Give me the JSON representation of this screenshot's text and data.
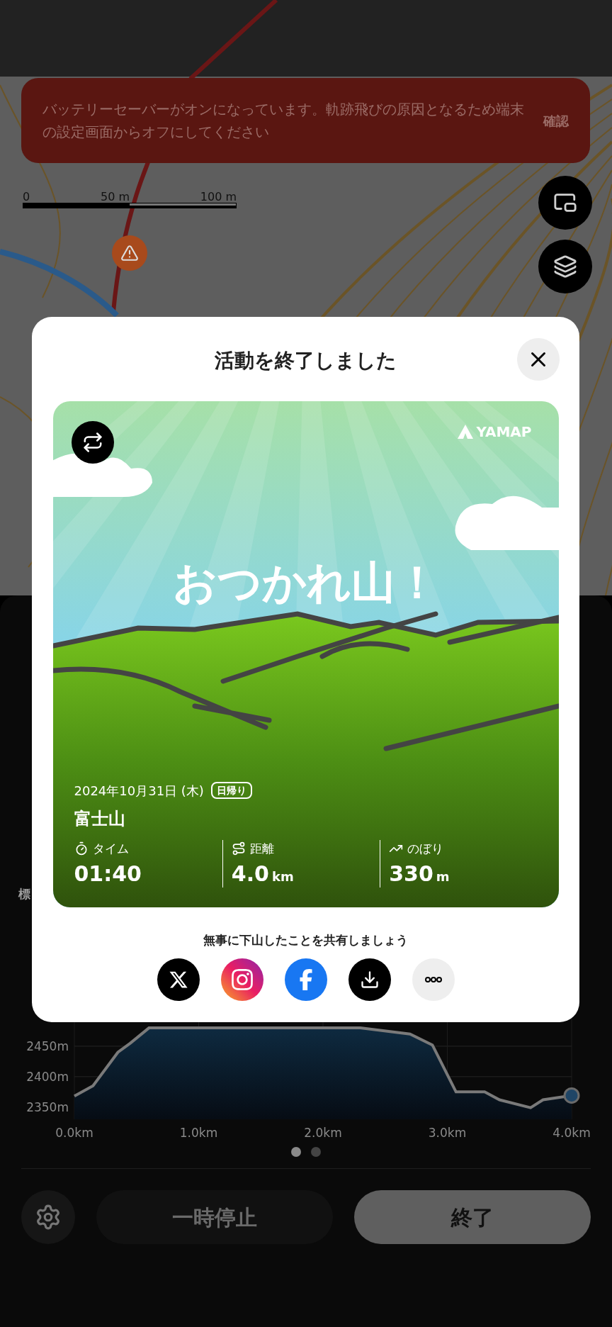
{
  "map": {
    "scale_labels": [
      "0",
      "50 m",
      "100 m"
    ],
    "buttons": [
      {
        "kind": "shrink"
      },
      {
        "kind": "layers"
      }
    ]
  },
  "banner": {
    "message": "バッテリーセーバーがオンになっています。軌跡飛びの原因となるため端末の設定画面からオフにしてください",
    "action": "確認"
  },
  "panel": {
    "chart_label": "標",
    "chart_data": {
      "type": "area",
      "x": [
        0,
        0.15,
        0.35,
        0.45,
        0.6,
        2.3,
        2.7,
        2.88,
        3.07,
        3.3,
        3.42,
        3.67,
        3.77,
        4.0
      ],
      "series": [
        {
          "color": "#7a7a7a",
          "values": [
            2368,
            2385,
            2440,
            2455,
            2480,
            2480,
            2470,
            2452,
            2375,
            2375,
            2362,
            2349,
            2362,
            2369
          ]
        }
      ],
      "xlim": [
        0,
        4
      ],
      "grid": true,
      "ylim": [
        2330,
        2600
      ],
      "xticks": [
        {
          "value": 0,
          "label": "0.0km"
        },
        {
          "value": 1,
          "label": "1.0km"
        },
        {
          "value": 2,
          "label": "2.0km"
        },
        {
          "value": 3,
          "label": "3.0km"
        },
        {
          "value": 4,
          "label": "4.0km"
        }
      ],
      "yticks": [
        {
          "value": 2350,
          "label": "2350m"
        },
        {
          "value": 2400,
          "label": "2400m"
        },
        {
          "value": 2450,
          "label": "2450m"
        }
      ]
    },
    "pages": [
      {
        "selected": true
      },
      {
        "selected": false
      }
    ],
    "buttons": [
      {
        "kind": "secondary",
        "label": "一時停止"
      },
      {
        "kind": "primary",
        "label": "終了"
      }
    ]
  },
  "dialog": {
    "title": "活動を終了しました",
    "card": {
      "logo": "YAMAP",
      "headline": "おつかれ山！",
      "date": "2024年10月31日 (木)",
      "badge": "日帰り",
      "mountain": "富士山",
      "stats": [
        {
          "kind": "time",
          "label": "タイム",
          "value": "01:40"
        },
        {
          "kind": "distance",
          "label": "距離",
          "value": "4.0",
          "unit": "km"
        },
        {
          "kind": "ascent",
          "label": "のぼり",
          "value": "330",
          "unit": "m"
        }
      ]
    },
    "share_prompt": "無事に下山したことを共有しましょう",
    "share_buttons": [
      {
        "kind": "x"
      },
      {
        "kind": "instagram"
      },
      {
        "kind": "facebook"
      },
      {
        "kind": "download"
      },
      {
        "kind": "more"
      }
    ]
  }
}
